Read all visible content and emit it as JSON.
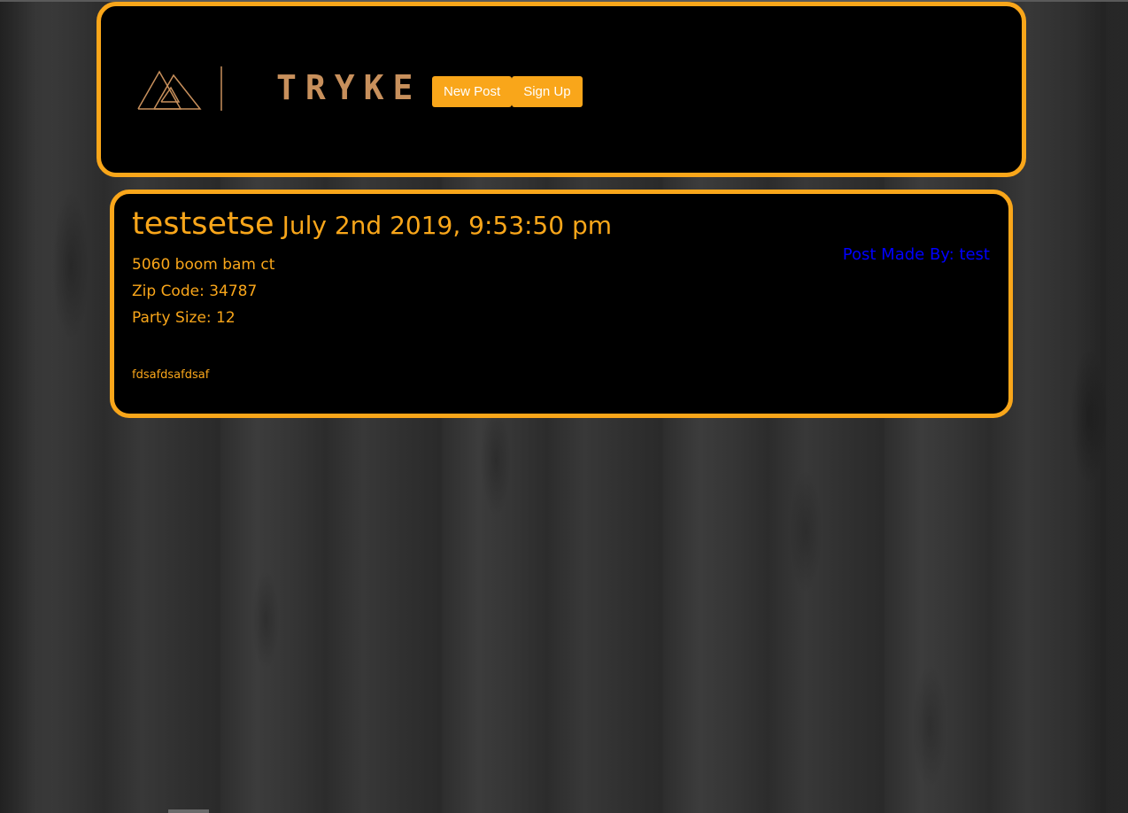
{
  "colors": {
    "accent": "#f9a61a",
    "panel_bg": "#000000",
    "logo": "#c8905c",
    "author_link": "#0000ff",
    "button_text": "#ffffff"
  },
  "header": {
    "logo": {
      "icon": "triangle-logo-icon",
      "text": "TRYKE"
    },
    "nav": {
      "new_post_label": "New Post",
      "sign_up_label": "Sign Up"
    }
  },
  "post": {
    "title": "testsetse",
    "date": "July 2nd 2019, 9:53:50 pm",
    "address": "5060 boom bam ct",
    "zip_code": "Zip Code: 34787",
    "party_size": "Party Size: 12",
    "body": "fdsafdsafdsaf",
    "author": "Post Made By: test"
  }
}
